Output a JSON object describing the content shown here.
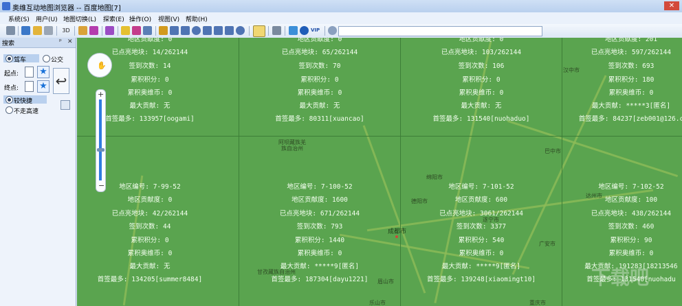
{
  "window": {
    "title": "奥维互动地图浏览器 -- 百度地图[7]",
    "close_label": "✕"
  },
  "menu": [
    "系统(S)",
    "用户(U)",
    "地图切换(L)",
    "探索(E)",
    "操作(O)",
    "视图(V)",
    "帮助(H)"
  ],
  "toolbar": {
    "vip_label": "VIP",
    "zoom3d_label": "3D"
  },
  "panel": {
    "title": "搜索",
    "pin": "ᵖ",
    "close": "✕",
    "mode_drive": "驾车",
    "mode_transit": "公交",
    "start_label": "起点:",
    "end_label": "终点:",
    "star": "★",
    "swap": "↩",
    "opt_fast": "较快捷",
    "opt_nohighway": "不走高速"
  },
  "map": {
    "top_row": [
      {
        "l0": "地区贡献度: 0",
        "l1": "已点亮地块: 14/262144",
        "l2": "签到次数: 14",
        "l3": "累积积分: 0",
        "l4": "累积奥维币: 0",
        "l5": "最大贡献: 无",
        "l6": "首签最多: 133957[oogami]"
      },
      {
        "l0": "地区贡献度: 0",
        "l1": "已点亮地块: 65/262144",
        "l2": "签到次数: 70",
        "l3": "累积积分: 0",
        "l4": "累积奥维币: 0",
        "l5": "最大贡献: 无",
        "l6": "首签最多: 80311[xuancao]"
      },
      {
        "l0": "地区贡献度: 0",
        "l1": "已点亮地块: 103/262144",
        "l2": "签到次数: 106",
        "l3": "累积积分: 0",
        "l4": "累积奥维币: 0",
        "l5": "最大贡献: 无",
        "l6": "首签最多: 131540[nuohaduo]"
      },
      {
        "l0": "地区贡献度: 201",
        "l1": "已点亮地块: 597/262144",
        "l2": "签到次数: 693",
        "l3": "累积积分: 180",
        "l4": "累积奥维币: 0",
        "l5": "最大贡献: *****3[匿名]",
        "l6": "首签最多: 84237[zeb001@126.c"
      }
    ],
    "bottom_row": [
      {
        "l0": "地区编号: 7-99-52",
        "l1": "地区贡献度: 0",
        "l2": "已点亮地块: 42/262144",
        "l3": "签到次数: 44",
        "l4": "累积积分: 0",
        "l5": "累积奥维币: 0",
        "l6": "最大贡献: 无",
        "l7": "首签最多: 134205[summer8484]"
      },
      {
        "l0": "地区编号: 7-100-52",
        "l1": "地区贡献度: 1600",
        "l2": "已点亮地块: 671/262144",
        "l3": "签到次数: 793",
        "l4": "累积积分: 1440",
        "l5": "累积奥维币: 0",
        "l6": "最大贡献: *****9[匿名]",
        "l7": "首签最多: 187304[dayu1221]"
      },
      {
        "l0": "地区编号: 7-101-52",
        "l1": "地区贡献度: 600",
        "l2": "已点亮地块: 3061/262144",
        "l3": "签到次数: 3377",
        "l4": "累积积分: 540",
        "l5": "累积奥维币: 0",
        "l6": "最大贡献: *****9[匿名]",
        "l7": "首签最多: 139248[xiaomingt10]"
      },
      {
        "l0": "地区编号: 7-102-52",
        "l1": "地区贡献度: 100",
        "l2": "已点亮地块: 438/262144",
        "l3": "签到次数: 460",
        "l4": "累积积分: 90",
        "l5": "累积奥维币: 0",
        "l6": "最大贡献: 191283[18213546",
        "l7": "首签最多: 131540[nuohadu"
      }
    ],
    "places": {
      "aba": "阿坝藏族羌",
      "aba2": "族自治州",
      "chengdu": "成都市",
      "hanzhong": "汉中市",
      "bazhong": "巴中市",
      "mianyang": "绵阳市",
      "deyang": "德阳市",
      "dazhou": "达州市",
      "guangan": "广安市",
      "suining": "遂宁市",
      "meishan": "眉山市",
      "leshan": "乐山市",
      "chongqing": "重庆市",
      "ganzi": "甘孜藏族自治州"
    },
    "zoom_plus": "+",
    "zoom_minus": "−",
    "nav_hand": "✋"
  },
  "watermark": "下载吧"
}
